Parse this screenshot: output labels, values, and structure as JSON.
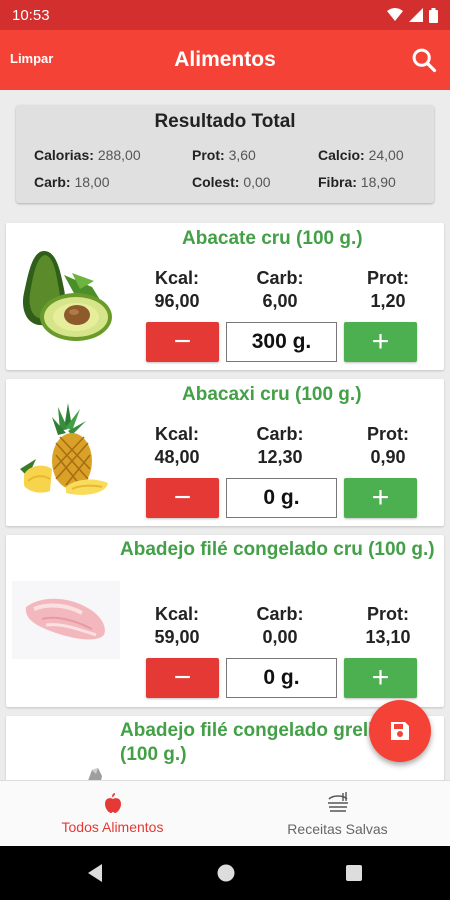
{
  "status": {
    "time": "10:53"
  },
  "app_bar": {
    "clear_label": "Limpar",
    "title": "Alimentos"
  },
  "summary": {
    "title": "Resultado Total",
    "items": [
      {
        "label": "Calorias:",
        "value": "288,00"
      },
      {
        "label": "Prot:",
        "value": "3,60"
      },
      {
        "label": "Calcio:",
        "value": "24,00"
      },
      {
        "label": "Carb:",
        "value": "18,00"
      },
      {
        "label": "Colest:",
        "value": "0,00"
      },
      {
        "label": "Fibra:",
        "value": "18,90"
      }
    ]
  },
  "nutrient_labels": {
    "kcal": "Kcal:",
    "carb": "Carb:",
    "prot": "Prot:"
  },
  "foods": [
    {
      "name": "Abacate cru (100 g.)",
      "kcal": "96,00",
      "carb": "6,00",
      "prot": "1,20",
      "quantity": "300 g.",
      "image": "avocado"
    },
    {
      "name": "Abacaxi cru (100 g.)",
      "kcal": "48,00",
      "carb": "12,30",
      "prot": "0,90",
      "quantity": "0 g.",
      "image": "pineapple"
    },
    {
      "name": "Abadejo filé congelado cru (100 g.)",
      "kcal": "59,00",
      "carb": "0,00",
      "prot": "13,10",
      "quantity": "0 g.",
      "image": "fish-fillet"
    },
    {
      "name": "Abadejo filé congelado grelhado (100 g.)",
      "image": "fish-fillet-grilled"
    }
  ],
  "buttons": {
    "minus": "−",
    "plus": "+"
  },
  "bottom_nav": [
    {
      "label": "Todos Alimentos",
      "icon": "apple-icon",
      "active": true
    },
    {
      "label": "Receitas Salvas",
      "icon": "recipes-icon",
      "active": false
    }
  ],
  "colors": {
    "primary": "#f44336",
    "status": "#d32f2f",
    "green": "#43a047",
    "red_button": "#e53935"
  }
}
